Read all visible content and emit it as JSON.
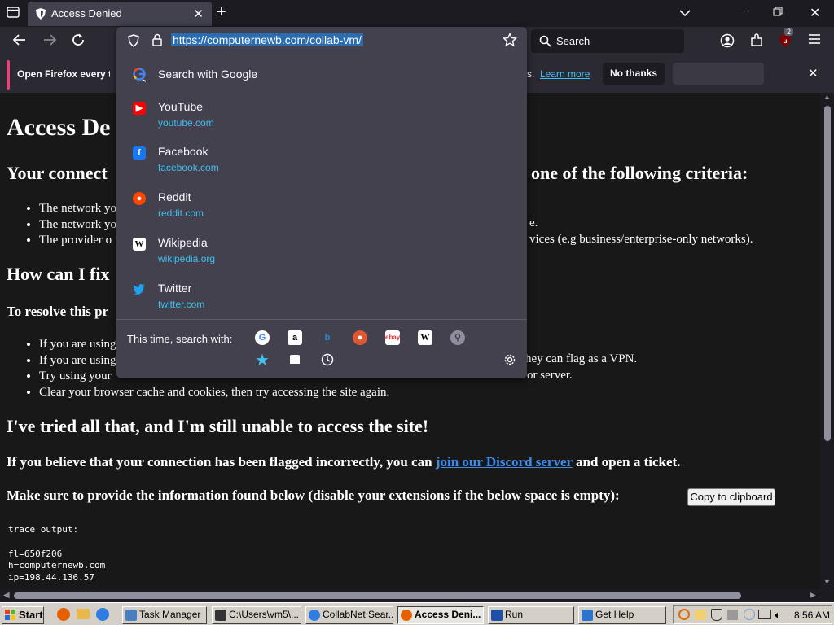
{
  "browser": {
    "tab": {
      "title": "Access Denied"
    },
    "url": "https://computernewb.com/collab-vm/",
    "search_placeholder": "Search",
    "extension_badge": "2",
    "notification": {
      "message": "Open Firefox every tim",
      "message_tail": "s.",
      "learn_more": "Learn more",
      "no_thanks": "No thanks"
    }
  },
  "url_dropdown": {
    "search_with_google": "Search with Google",
    "suggestions": [
      {
        "name": "YouTube",
        "url": "youtube.com",
        "icon": "youtube-icon",
        "color": "#ff0000"
      },
      {
        "name": "Facebook",
        "url": "facebook.com",
        "icon": "facebook-icon",
        "color": "#1877f2"
      },
      {
        "name": "Reddit",
        "url": "reddit.com",
        "icon": "reddit-icon",
        "color": "#ff4500"
      },
      {
        "name": "Wikipedia",
        "url": "wikipedia.org",
        "icon": "wikipedia-icon",
        "color": "#ffffff"
      },
      {
        "name": "Twitter",
        "url": "twitter.com",
        "icon": "twitter-icon",
        "color": "#1da1f2"
      }
    ],
    "this_time_label": "This time, search with:",
    "engines": [
      "google-icon",
      "amazon-icon",
      "bing-icon",
      "duckduckgo-icon",
      "ebay-icon",
      "wikipedia-icon",
      "search-icon",
      "bookmarks-icon",
      "tabs-icon",
      "history-icon"
    ]
  },
  "page": {
    "title": "Access De",
    "h2_connect_left": "Your connect",
    "h2_connect_right": "one of the following criteria:",
    "bullets1": [
      {
        "left": "The network yo",
        "right": ""
      },
      {
        "left": "The network yo",
        "right": "e."
      },
      {
        "left": "The provider o",
        "right": "vices (e.g business/enterprise-only networks)."
      }
    ],
    "h2_fix": "How can I fix",
    "resolve": "To resolve this pr",
    "bullets2": [
      {
        "left": "If you are using",
        "right": ""
      },
      {
        "left": "If you are using",
        "right": "hey can flag as a VPN."
      },
      {
        "left": "Try using your",
        "right": "or server."
      },
      {
        "left": "Clear your browser cache and cookies, then try accessing the site again.",
        "right": ""
      }
    ],
    "h2_tried": "I've tried all that, and I'm still unable to access the site!",
    "flagged_pre": "If you believe that your connection has been flagged incorrectly, you can",
    "flagged_link": "join our Discord server",
    "flagged_post": "and open a ticket.",
    "make_sure": "Make sure to provide the information found below (disable your extensions if the below space is empty):",
    "copy_button": "Copy to clipboard",
    "trace": "trace output:\n\nfl=650f206\nh=computernewb.com\nip=198.44.136.57"
  },
  "taskbar": {
    "start": "Start",
    "items": [
      {
        "label": "Task Manager",
        "active": false
      },
      {
        "label": "C:\\Users\\vm5\\...",
        "active": false
      },
      {
        "label": "CollabNet Sear...",
        "active": false
      },
      {
        "label": "Access Deni...",
        "active": true
      },
      {
        "label": "Run",
        "active": false
      },
      {
        "label": "Get Help",
        "active": false
      }
    ],
    "clock": "8:56 AM"
  }
}
